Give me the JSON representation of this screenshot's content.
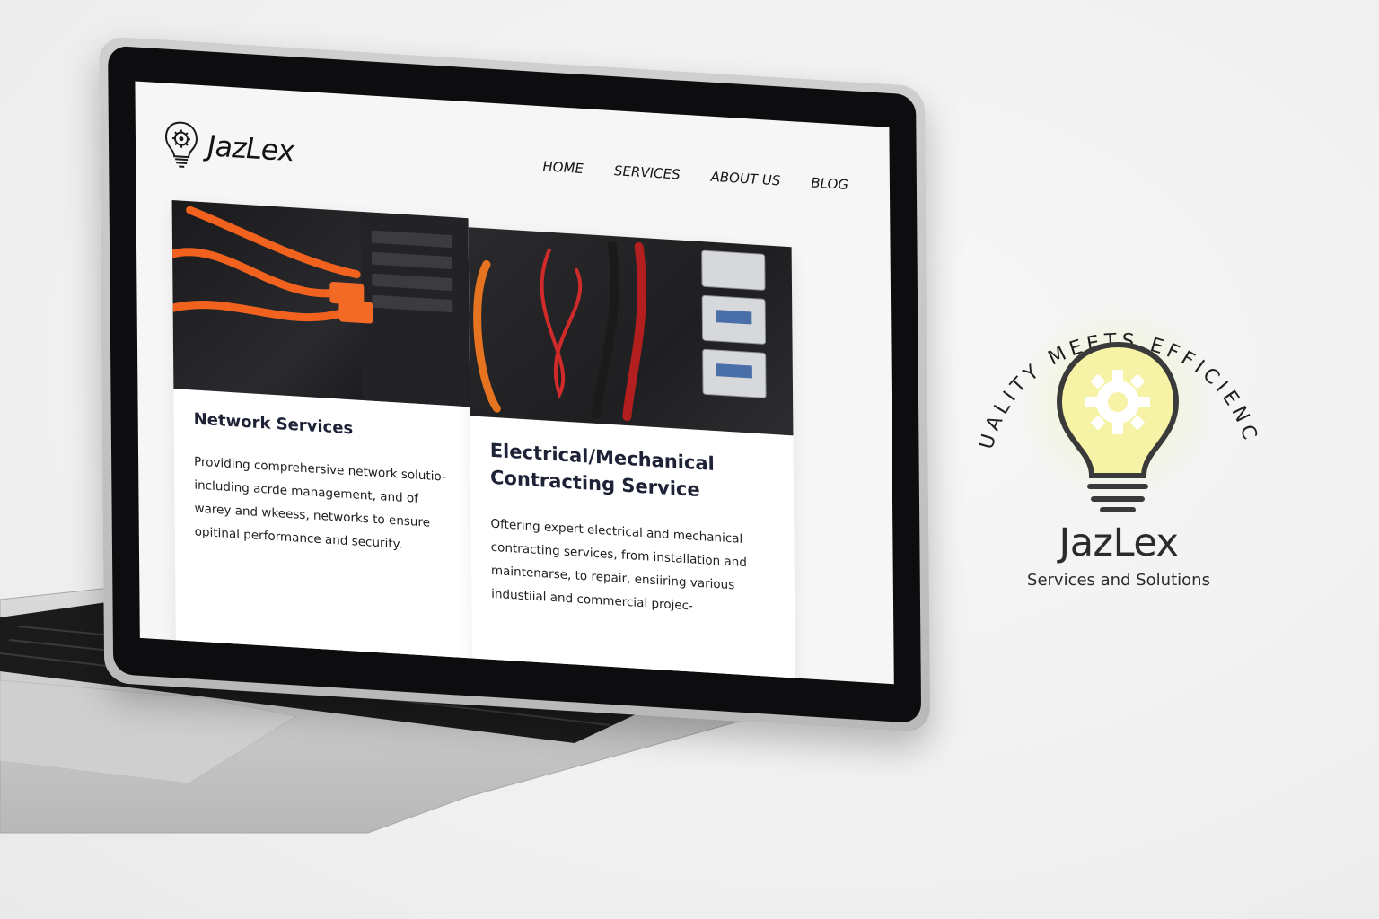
{
  "website": {
    "logo_text": "JazLex",
    "nav": [
      "HOME",
      "SERVICES",
      "ABOUT US",
      "BLOG"
    ],
    "cards": [
      {
        "title": "Network Services",
        "description": "Providing comprehersive network solutio- including acrde management, and of warey and wkeess, networks to ensure opitinal performance and security."
      },
      {
        "title": "Electrical/Mechanical Contracting Service",
        "description": "Oftering expert electrical and mechanical contracting services, from installation and maintenarse, to repair, ensiiring various industiial and commercial projec-"
      }
    ]
  },
  "brand": {
    "arc_text": "QUALITY MEETS EFFICIENCY",
    "name": "JazLex",
    "tagline": "Services and Solutions"
  },
  "colors": {
    "bulb_glow": "#f6f3a6",
    "brand_text": "#2b2b2b",
    "cable_orange": "#f0621e",
    "card_title": "#1d2236"
  },
  "icons": {
    "logo": "lightbulb-gear-icon"
  }
}
